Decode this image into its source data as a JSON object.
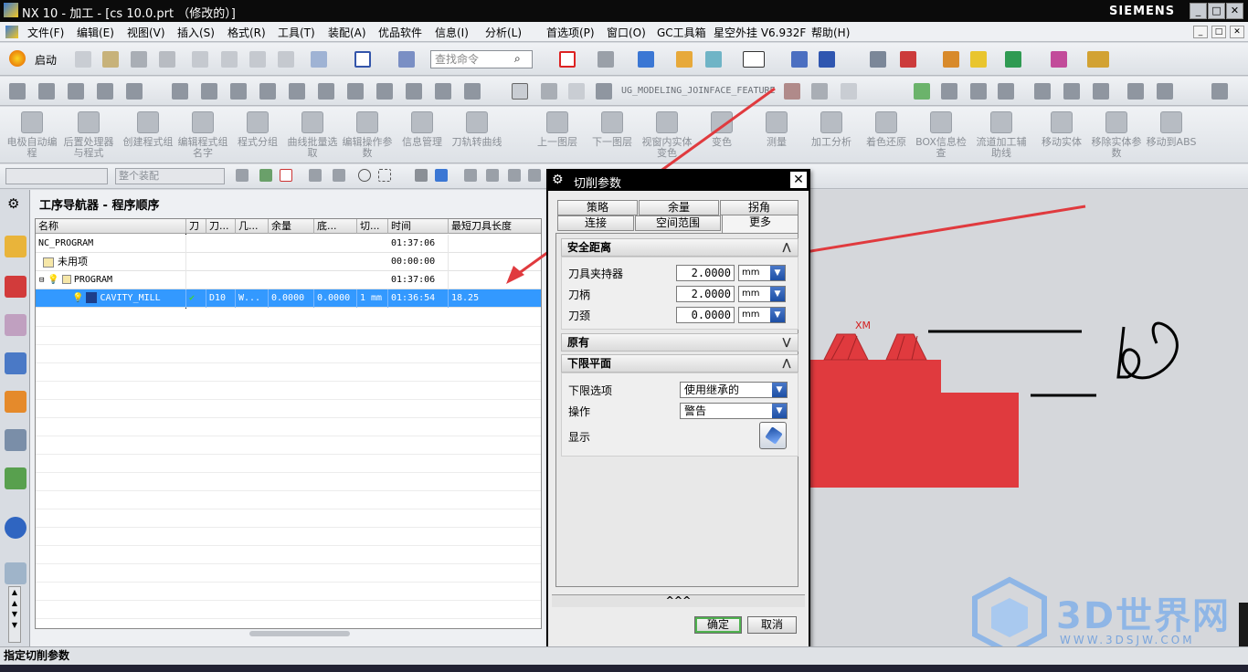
{
  "window": {
    "title": "NX 10 - 加工 - [cs 10.0.prt （修改的）]",
    "brand": "SIEMENS"
  },
  "menus": [
    "文件(F)",
    "编辑(E)",
    "视图(V)",
    "插入(S)",
    "格式(R)",
    "工具(T)",
    "装配(A)",
    "优品软件",
    "信息(I)",
    "分析(L)",
    "首选项(P)",
    "窗口(O)",
    "GC工具箱",
    "星空外挂 V6.932F",
    "帮助(H)"
  ],
  "toolbar1": {
    "start_label": "启动",
    "search_placeholder": "查找命令"
  },
  "toolbar2": {
    "feature_label": "UG_MODELING_JOINFACE_FEATURE"
  },
  "toolbar3": [
    "电极自动编程",
    "后置处理器与程式",
    "创建程式组",
    "编辑程式组名字",
    "程式分组",
    "曲线批量选取",
    "编辑操作参数",
    "信息管理",
    "刀轨转曲线",
    "上一图层",
    "下一图层",
    "视窗内实体变色",
    "变色",
    "测量",
    "加工分析",
    "着色还原",
    "BOX信息检查",
    "流道加工辅助线",
    "移动实体",
    "移除实体参数",
    "移动到ABS"
  ],
  "toolbar4": {
    "filter1": "",
    "filter2": "整个装配"
  },
  "navigator": {
    "title": "工序导航器 - 程序顺序",
    "columns": [
      "名称",
      "刀",
      "刀...",
      "几...",
      "余量",
      "底...",
      "切...",
      "时间",
      "最短刀具长度"
    ],
    "rows": [
      {
        "name": "NC_PROGRAM",
        "check": "",
        "tool": "",
        "geom": "",
        "stock": "",
        "floor": "",
        "cut": "",
        "time": "01:37:06",
        "minlen": ""
      },
      {
        "name": "未用项",
        "check": "",
        "tool": "",
        "geom": "",
        "stock": "",
        "floor": "",
        "cut": "",
        "time": "00:00:00",
        "minlen": ""
      },
      {
        "name": "PROGRAM",
        "check": "",
        "tool": "",
        "geom": "",
        "stock": "",
        "floor": "",
        "cut": "",
        "time": "01:37:06",
        "minlen": ""
      },
      {
        "name": "CAVITY_MILL",
        "check": "✔",
        "tool": "D10",
        "geom": "W...",
        "stock": "0.0000",
        "floor": "0.0000",
        "cut": "1 mm",
        "time": "01:36:54",
        "minlen": "18.25"
      }
    ]
  },
  "dialog": {
    "title": "切削参数",
    "tabs_row1": [
      "策略",
      "余量",
      "拐角"
    ],
    "tabs_row2": [
      "连接",
      "空间范围",
      "更多"
    ],
    "sections": {
      "safe": {
        "title": "安全距离",
        "fields": [
          {
            "label": "刀具夹持器",
            "value": "2.0000",
            "unit": "mm"
          },
          {
            "label": "刀柄",
            "value": "2.0000",
            "unit": "mm"
          },
          {
            "label": "刀颈",
            "value": "0.0000",
            "unit": "mm"
          }
        ]
      },
      "legacy": {
        "title": "原有"
      },
      "lower": {
        "title": "下限平面",
        "option_label": "下限选项",
        "option_value": "使用继承的",
        "action_label": "操作",
        "action_value": "警告",
        "display_label": "显示"
      }
    },
    "expand": "^^^",
    "ok": "确定",
    "cancel": "取消"
  },
  "viewport": {
    "axis_label": "XM",
    "part_color": "#e03a3e"
  },
  "watermark": {
    "text": "3D世界网",
    "url": "WWW.3DSJW.COM"
  },
  "status": "指定切削参数"
}
